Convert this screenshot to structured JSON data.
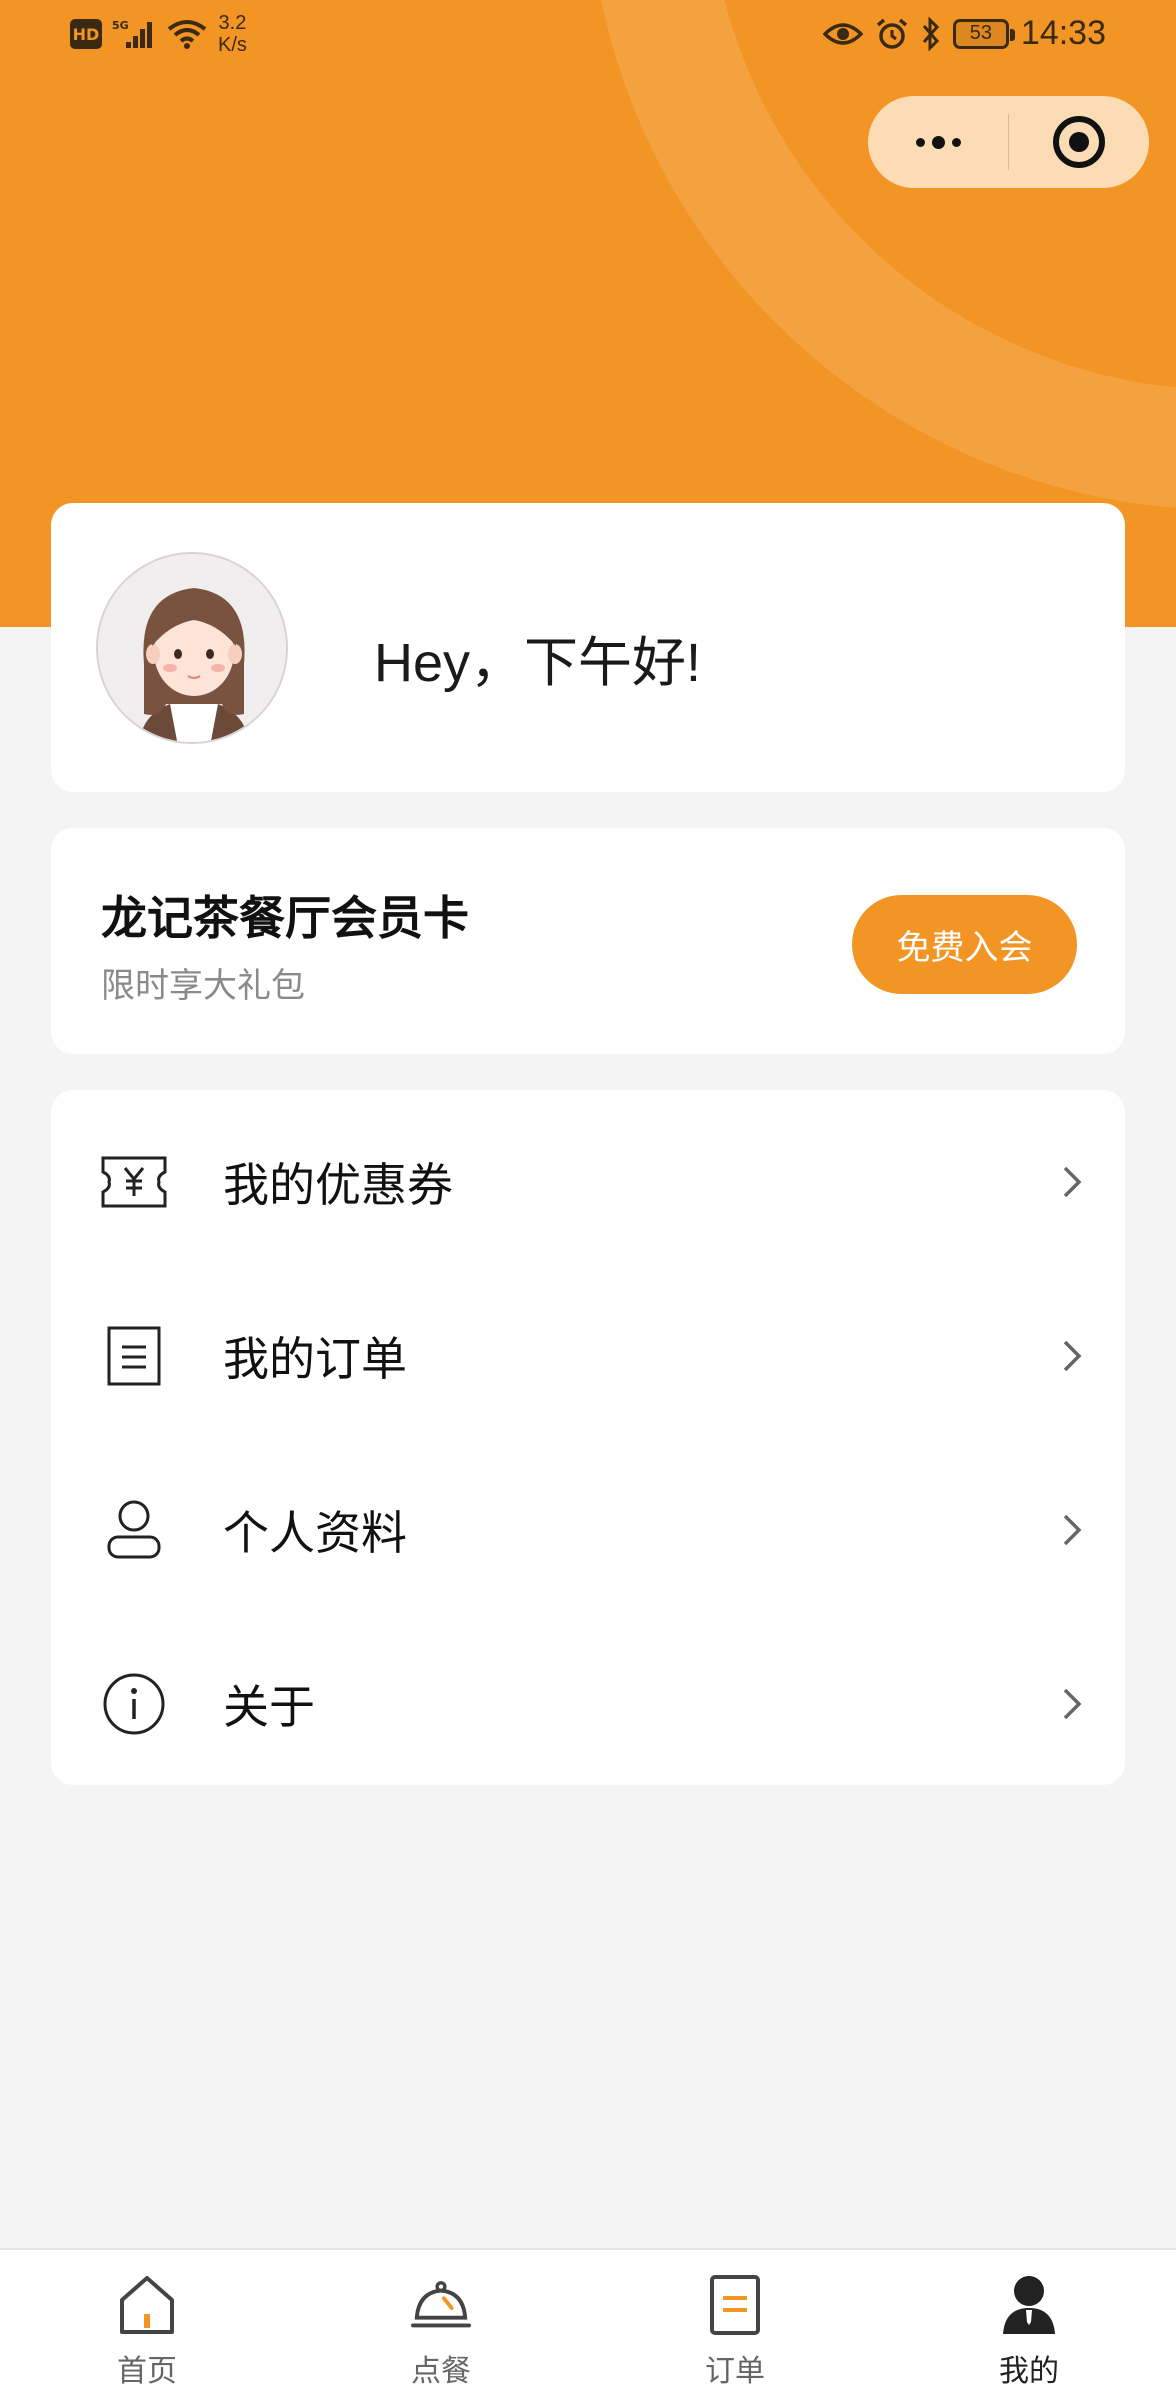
{
  "status_bar": {
    "hd_badge": "HD",
    "network": "5G",
    "speed_value": "3.2",
    "speed_unit": "K/s",
    "battery": "53",
    "time": "14:33"
  },
  "capsule": {
    "more_icon": "more-dots-icon",
    "close_icon": "target-circle-icon"
  },
  "profile": {
    "greeting": "Hey，下午好!"
  },
  "membership": {
    "title": "龙记茶餐厅会员卡",
    "subtitle": "限时享大礼包",
    "join_label": "免费入会"
  },
  "menu": {
    "items": [
      {
        "label": "我的优惠券",
        "icon": "coupon-icon"
      },
      {
        "label": "我的订单",
        "icon": "order-list-icon"
      },
      {
        "label": "个人资料",
        "icon": "user-icon"
      },
      {
        "label": "关于",
        "icon": "info-icon"
      }
    ]
  },
  "tabbar": {
    "tabs": [
      {
        "label": "首页",
        "icon": "home-icon"
      },
      {
        "label": "点餐",
        "icon": "cloche-icon"
      },
      {
        "label": "订单",
        "icon": "order-icon"
      },
      {
        "label": "我的",
        "icon": "profile-icon",
        "active": true
      }
    ]
  },
  "colors": {
    "accent": "#f39524",
    "accent_light": "#fbdcb4",
    "background": "#f4f4f4"
  }
}
